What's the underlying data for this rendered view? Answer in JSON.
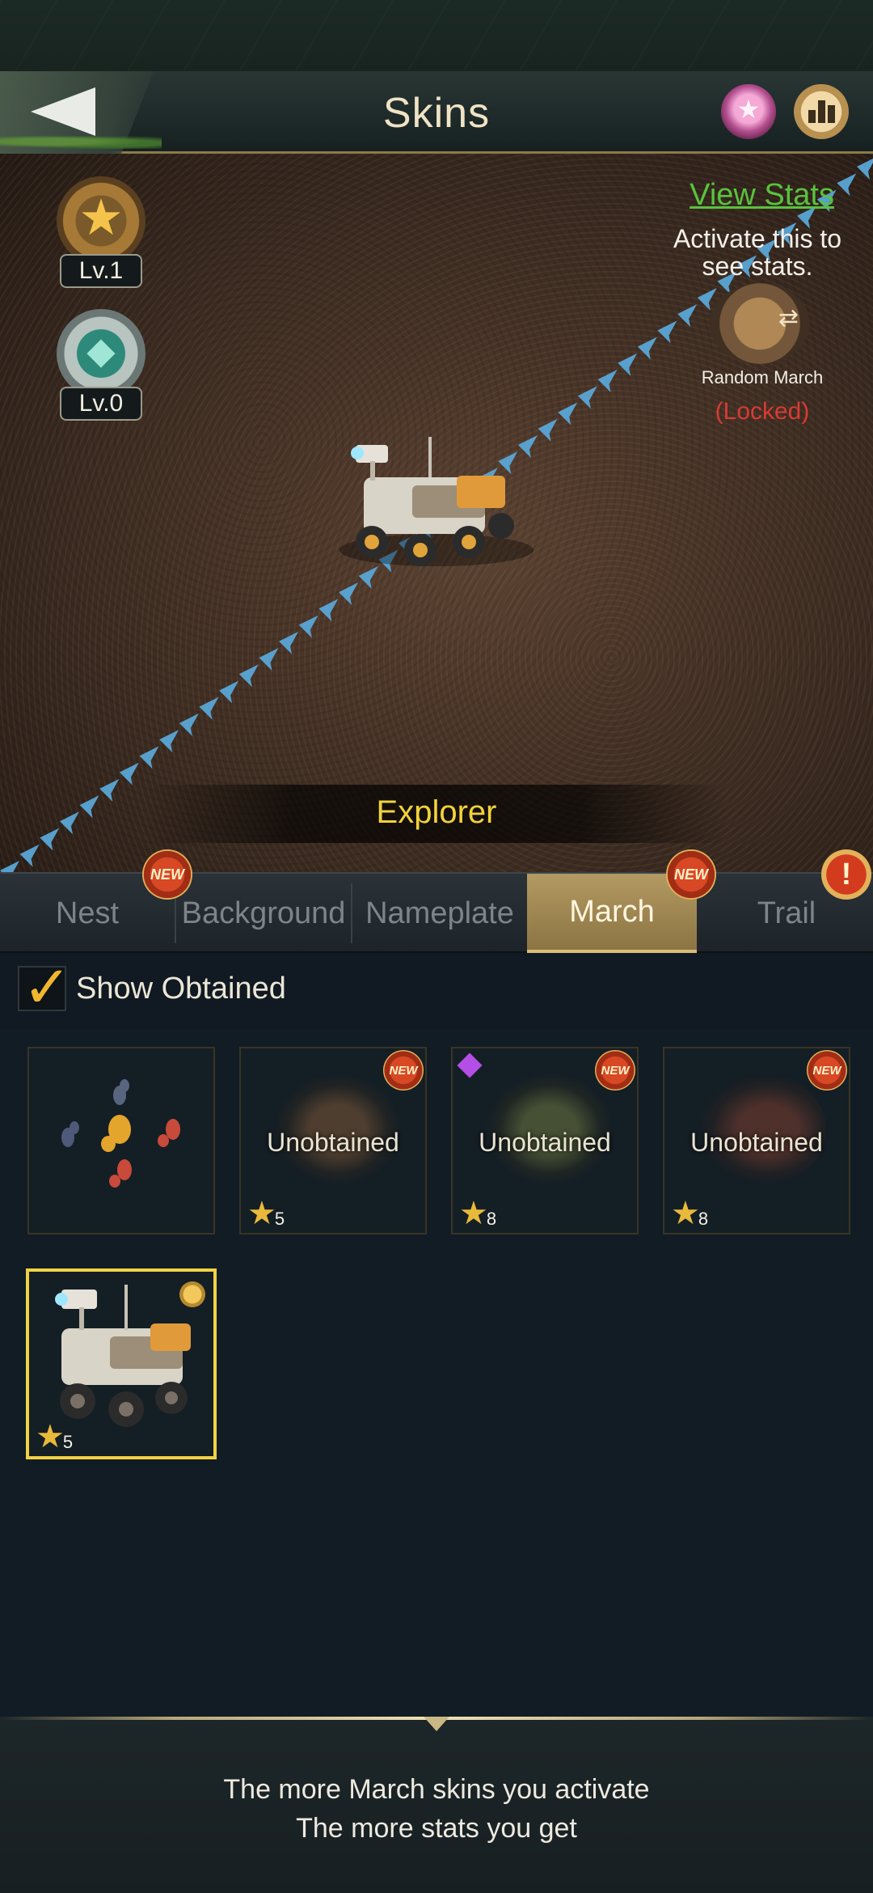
{
  "header": {
    "title": "Skins",
    "back_icon": "back-arrow-icon",
    "icons": [
      "gem-icon",
      "ranking-icon"
    ]
  },
  "preview": {
    "badges": [
      {
        "icon": "star-medal-icon",
        "level": "Lv.1"
      },
      {
        "icon": "leaf-medal-icon",
        "level": "Lv.0"
      }
    ],
    "view_stats": "View Stats",
    "activate_hint": "Activate this to see stats.",
    "random_march_label": "Random March",
    "locked_label": "(Locked)",
    "skin_name": "Explorer"
  },
  "tabs": [
    {
      "label": "Nest",
      "active": false,
      "badge": ""
    },
    {
      "label": "Background",
      "active": false,
      "badge": "NEW"
    },
    {
      "label": "Nameplate",
      "active": false,
      "badge": ""
    },
    {
      "label": "March",
      "active": true,
      "badge": "NEW"
    },
    {
      "label": "Trail",
      "active": false,
      "badge": "!"
    }
  ],
  "filter": {
    "label": "Show Obtained",
    "checked": true
  },
  "skins": [
    {
      "status": "",
      "stars": "",
      "badge": "",
      "icon": "ants-icon"
    },
    {
      "status": "Unobtained",
      "stars": "5",
      "badge": "NEW",
      "icon": "spider-icon"
    },
    {
      "status": "Unobtained",
      "stars": "8",
      "badge": "NEW",
      "icon": "wasp-icon"
    },
    {
      "status": "Unobtained",
      "stars": "8",
      "badge": "NEW",
      "icon": "beetle-icon"
    },
    {
      "status": "",
      "stars": "5",
      "badge": "",
      "icon": "rover-icon",
      "selected": true
    }
  ],
  "footer": {
    "line1": "The more March skins you activate",
    "line2": "The more stats you get"
  },
  "colors": {
    "accent_gold": "#f2d23a",
    "link_green": "#59c23e",
    "locked_red": "#d93a34",
    "tab_active": "#b39a63"
  }
}
